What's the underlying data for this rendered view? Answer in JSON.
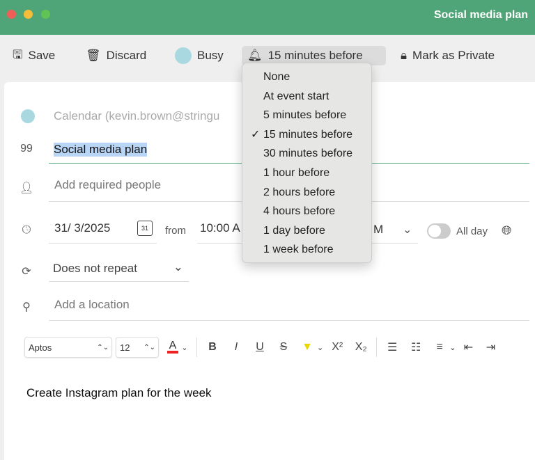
{
  "window": {
    "title": "Social media plan"
  },
  "toolbar": {
    "save": "Save",
    "discard": "Discard",
    "busy": "Busy",
    "reminder": "15 minutes before",
    "private": "Mark as Private"
  },
  "reminder_menu": {
    "items": [
      "None",
      "At event start",
      "5 minutes before",
      "15 minutes before",
      "30 minutes before",
      "1 hour before",
      "2 hours before",
      "4 hours before",
      "1 day before",
      "1 week before"
    ],
    "selected": "15 minutes before"
  },
  "form": {
    "calendar": "Calendar (kevin.brown@stringu",
    "title": "Social media plan",
    "people_placeholder": "Add required people",
    "date": "31/ 3/2025",
    "cal_icon_day": "31",
    "from": "from",
    "start_time": "10:00 A",
    "end_time_partial": "M",
    "all_day": "All day",
    "repeat": "Does not repeat",
    "location_placeholder": "Add a location"
  },
  "format": {
    "font": "Aptos",
    "size": "12"
  },
  "body": {
    "text": "Create Instagram plan for the week"
  },
  "colors": {
    "titlebar": "#4fa577",
    "busy": "#a9d8e0",
    "accent": "#4fa577"
  }
}
